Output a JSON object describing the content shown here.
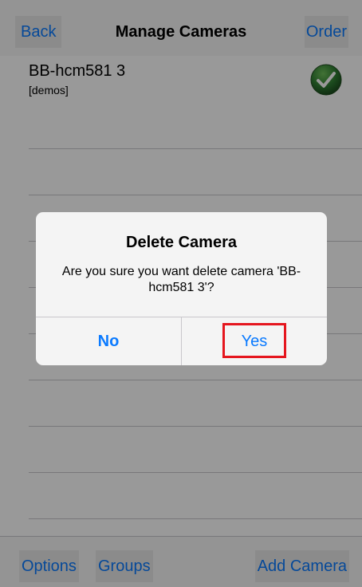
{
  "navbar": {
    "back_label": "Back",
    "title": "Manage Cameras",
    "order_label": "Order"
  },
  "camera_list": {
    "items": [
      {
        "name": "BB-hcm581 3",
        "group": "[demos]",
        "status_icon": "checkmark-icon"
      }
    ],
    "check_color": "#2e7d32"
  },
  "toolbar": {
    "options_label": "Options",
    "groups_label": "Groups",
    "add_camera_label": "Add Camera"
  },
  "alert": {
    "title": "Delete Camera",
    "message": "Are you sure you want delete camera 'BB-hcm581 3'?",
    "no_label": "No",
    "yes_label": "Yes"
  },
  "colors": {
    "accent": "#0a7aff",
    "highlight": "#e5161e"
  }
}
